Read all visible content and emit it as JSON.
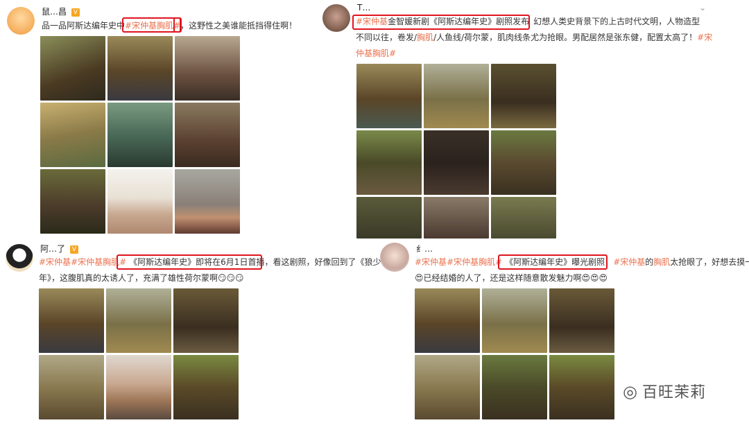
{
  "post1": {
    "username": "鼠…昌",
    "text_before": "品一品阿斯达编年史中",
    "tag": "#宋仲基胸肌#",
    "text_after": "，这野性之美谁能抵挡得住啊！"
  },
  "post2": {
    "username": "T…",
    "tag_start": "#宋仲基",
    "highlight_text": "金智媛新剧《阿斯达编年史》剧照发布",
    "text_after": "幻想人类史背景下的上古时代文明，人物造型",
    "line2_a": "不同以往，卷发/",
    "line2_tag": "胸肌",
    "line2_b": "/人鱼线/荷尔蒙，肌肉线条尤为抢眼。男配居然是张东健，配置太高了！",
    "line2_tag2": "#宋",
    "line3_tag": "仲基胸肌#"
  },
  "post3": {
    "username": "阿…了",
    "tags": "#宋仲基#宋仲基胸肌#",
    "highlight_text": "《阿斯达编年史》即将在6月1日首播",
    "text_after": "，看这剧照，好像回到了《狼少",
    "line2": "年》，这腹肌真的太诱人了，充满了雄性荷尔蒙啊",
    "emoji": "😏😏😏"
  },
  "post4": {
    "username": "纟…",
    "tags": "#宋仲基#宋仲基胸肌#",
    "highlight_text": "《阿斯达编年史》曝光剧照",
    "text_a": "，",
    "tag_name": "#宋仲基",
    "text_b": "的",
    "tag_chest": "胸肌",
    "text_c": "太抢眼了，好想去摸一下",
    "line2_emoji": "😍",
    "line2": "已经结婚的人了，还是这样随意散发魅力啊",
    "emoji_end": "😍😍😍"
  },
  "watermark": "百旺茉莉",
  "colors": {
    "tag": "#eb7350",
    "highlight": "#e0141e",
    "verified": "#f5a623"
  }
}
